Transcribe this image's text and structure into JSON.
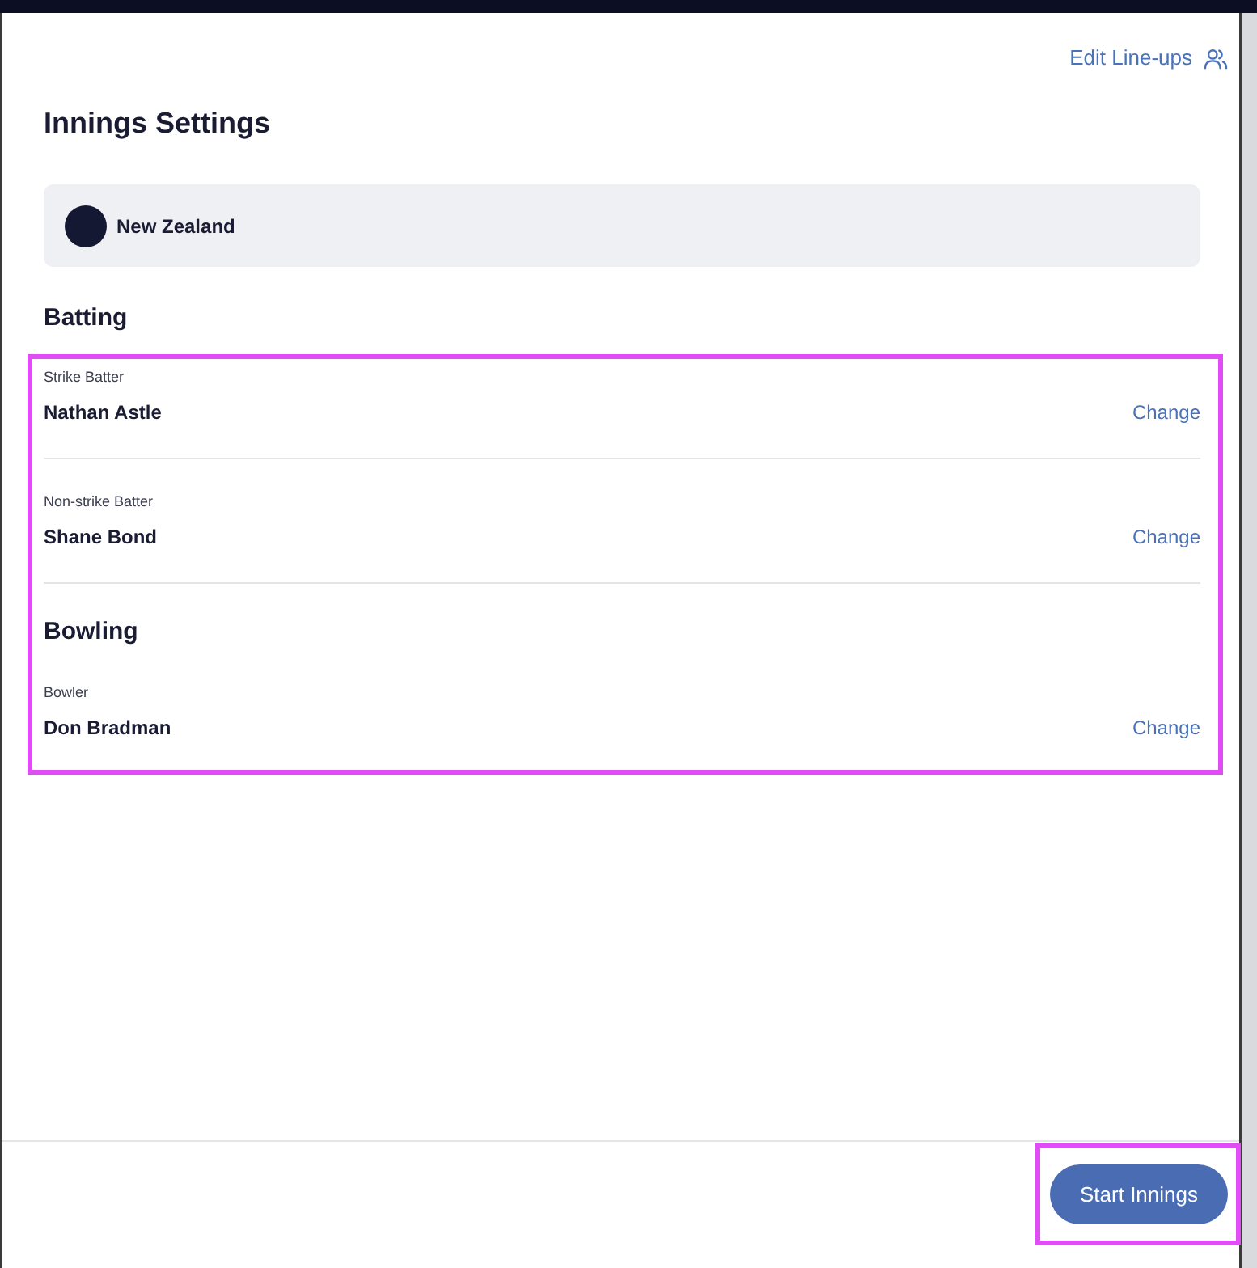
{
  "header": {
    "link": "Edit Line-ups"
  },
  "title": "Innings Settings",
  "team": {
    "name": "New Zealand"
  },
  "batting_heading": "Batting",
  "highlight_panel": {
    "highlighted": true,
    "items": [
      {
        "kind": "player",
        "label": "Strike Batter",
        "name": "Nathan Astle",
        "action": "Change"
      },
      {
        "kind": "player",
        "label": "Non-strike Batter",
        "name": "Shane Bond",
        "action": "Change"
      },
      {
        "kind": "heading",
        "text": "Bowling"
      },
      {
        "kind": "player",
        "label": "Bowler",
        "name": "Don Bradman",
        "action": "Change"
      }
    ]
  },
  "footer": {
    "button": {
      "label": "Start Innings",
      "highlighted": true
    }
  }
}
